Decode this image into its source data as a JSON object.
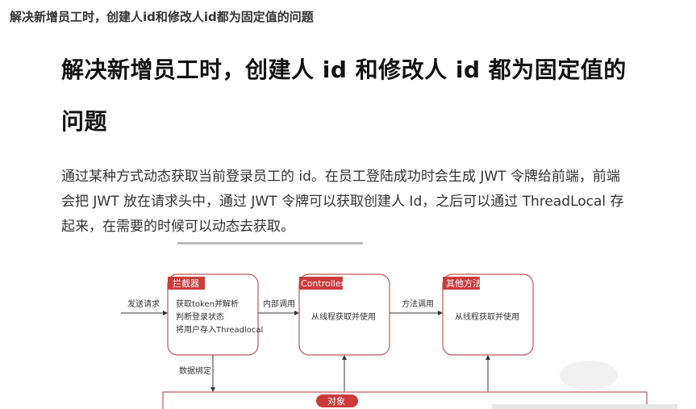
{
  "page": {
    "top_title": "解决新增员工时，创建人id和修改人id都为固定值的问题",
    "heading": "解决新增员工时，创建人 id 和修改人 id 都为固定值的问题",
    "paragraph": "通过某种方式动态获取当前登录员工的 id。在员工登陆成功时会生成 JWT 令牌给前端，前端会把 JWT 放在请求头中，通过 JWT 令牌可以获取创建人 Id，之后可以通过 ThreadLocal 存起来，在需要的时候可以动态去获取。"
  },
  "diagram": {
    "start_label": "发送请求",
    "interceptor": {
      "tag": "拦截器",
      "lines": [
        "获取token并解析",
        "判断登录状态",
        "将用户存入Threadlocal"
      ]
    },
    "edge_inner_call": "内部调用",
    "controller": {
      "tag": "Controller",
      "line": "从线程获取并使用"
    },
    "edge_method_call": "方法调用",
    "other_method": {
      "tag": "其他方法",
      "line": "从线程获取并使用"
    },
    "edge_data_bind": "数据绑定",
    "bottom_tag": "对象"
  }
}
